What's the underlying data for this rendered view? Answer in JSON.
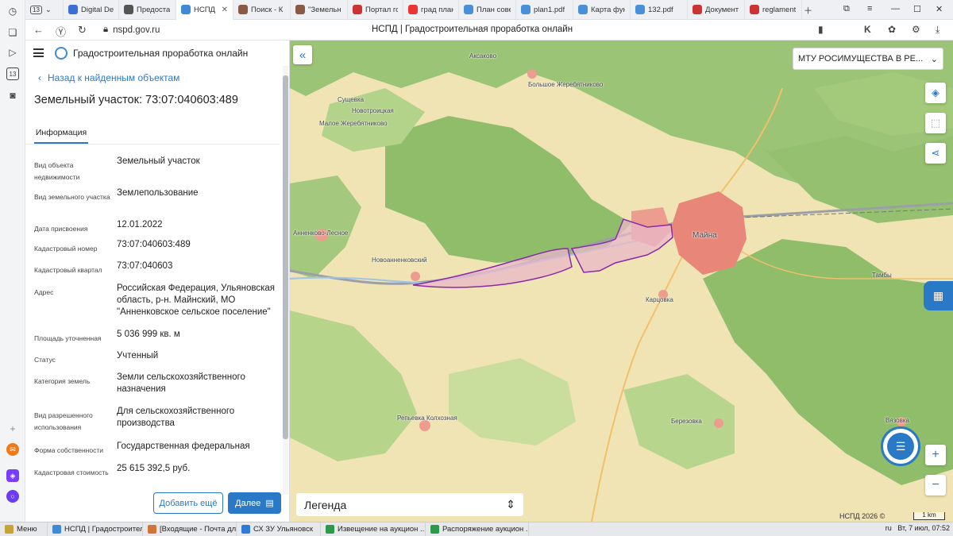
{
  "browser": {
    "tab_count": "13",
    "tabs": [
      {
        "label": "Digital De",
        "color": "#3b6fd6"
      },
      {
        "label": "Предоста",
        "color": "#555"
      },
      {
        "label": "НСПД |",
        "color": "#3d8bd6",
        "active": true
      },
      {
        "label": "Поиск - К",
        "color": "#8a5a44"
      },
      {
        "label": "\"Земельн",
        "color": "#8a5a44"
      },
      {
        "label": "Портал го",
        "color": "#c33"
      },
      {
        "label": "град план",
        "color": "#e33"
      },
      {
        "label": "План сове",
        "color": "#4a90d9"
      },
      {
        "label": "plan1.pdf",
        "color": "#4a90d9"
      },
      {
        "label": "Карта фун",
        "color": "#4a90d9"
      },
      {
        "label": "132.pdf",
        "color": "#4a90d9"
      },
      {
        "label": "Документ",
        "color": "#c33"
      },
      {
        "label": "reglament",
        "color": "#c33"
      }
    ],
    "url": "nspd.gov.ru",
    "page_title": "НСПД | Градостроительная проработка онлайн"
  },
  "app": {
    "title": "Градостроительная проработка онлайн",
    "back_label": "Назад к найденным объектам",
    "object_title": "Земельный участок: 73:07:040603:489",
    "tab_info": "Информация",
    "fields": [
      {
        "label": "Вид объекта недвижимости",
        "value": "Земельный участок"
      },
      {
        "label": "Вид земельного участка",
        "value": "Землепользование"
      },
      {
        "label": "Дата присвоения",
        "value": "12.01.2022"
      },
      {
        "label": "Кадастровый номер",
        "value": "73:07:040603:489"
      },
      {
        "label": "Кадастровый квартал",
        "value": "73:07:040603"
      },
      {
        "label": "Адрес",
        "value": "Российская Федерация, Ульяновская область, р-н. Майнский, МО \"Анненковское сельское поселение\""
      },
      {
        "label": "Площадь уточненная",
        "value": "5 036 999 кв. м"
      },
      {
        "label": "Статус",
        "value": "Учтенный"
      },
      {
        "label": "Категория земель",
        "value": "Земли сельскохозяйственного назначения"
      },
      {
        "label": "Вид разрешенного использования",
        "value": "Для сельскохозяйственного производства"
      },
      {
        "label": "Форма собственности",
        "value": "Государственная федеральная"
      },
      {
        "label": "Кадастровая стоимость",
        "value": "25 615 392,5 руб."
      }
    ],
    "btn_add": "Добавить ещё",
    "btn_next": "Далее"
  },
  "map": {
    "org_select": "МТУ РОСИМУЩЕСТВА В РЕ...",
    "legend": "Легенда",
    "copyright": "НСПД 2026 ©",
    "scale": "1 km",
    "labels": [
      "Аксаково",
      "Большое Жеребятниково",
      "Сущевка",
      "Новотроицкая",
      "Малое Жеребятниково",
      "Анненково-Лесное",
      "Новоанненковский",
      "Майна",
      "Тамбы",
      "Карцовка",
      "Репьевка Колхозная",
      "Березовка",
      "Вязовка"
    ]
  },
  "taskbar": {
    "items": [
      "Меню",
      "НСПД | Градостроитель...",
      "[Входящие - Почта для ...",
      "СХ ЗУ Ульяновск",
      "Извещение на аукцион ...",
      "Распоряжение аукцион ..."
    ],
    "lang": "ru",
    "clock": "Вт, 7 июл, 07:52"
  }
}
